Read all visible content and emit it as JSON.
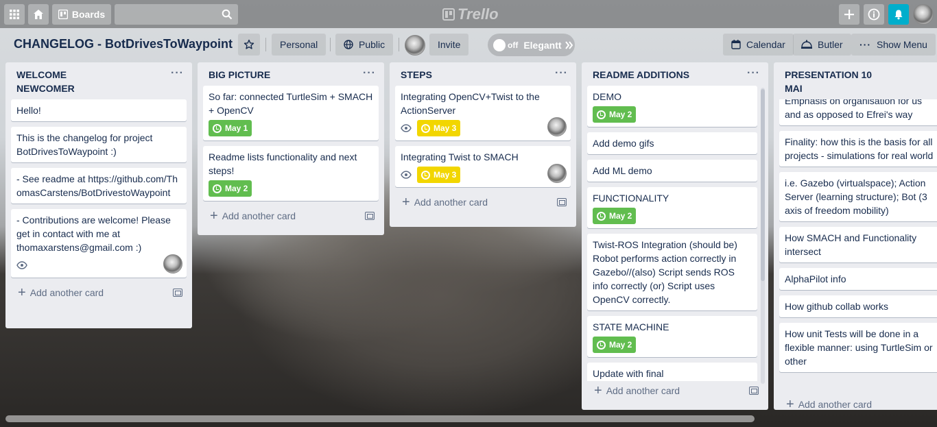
{
  "header": {
    "boards_label": "Boards",
    "logo_text": "Trello"
  },
  "board": {
    "title": "CHANGELOG - BotDrivesToWaypoint",
    "personal_label": "Personal",
    "public_label": "Public",
    "invite_label": "Invite",
    "toggle_state": "off",
    "toggle_label": "Elegantt",
    "calendar_label": "Calendar",
    "butler_label": "Butler",
    "show_menu_label": "Show Menu"
  },
  "footer_labels": {
    "add_card": "Add another card"
  },
  "lists": [
    {
      "title": "WELCOME NEWCOMER",
      "cards": [
        {
          "text": "Hello!"
        },
        {
          "text": "This is the changelog for project BotDrivesToWaypoint :)"
        },
        {
          "text": "- See readme at https://github.com/ThomasCarstens/BotDrivestoWaypoint"
        },
        {
          "text": "- Contributions are welcome! Please get in contact with me at thomaxarstens@gmail.com :)"
        }
      ]
    },
    {
      "title": "BIG PICTURE",
      "cards": [
        {
          "text": "So far: connected TurtleSim + SMACH + OpenCV",
          "date": "May 1"
        },
        {
          "text": "Readme lists functionality and next steps!",
          "date": "May 2"
        }
      ]
    },
    {
      "title": "STEPS",
      "cards": [
        {
          "text": "Integrating OpenCV+Twist to the ActionServer",
          "date": "May 3"
        },
        {
          "text": "Integrating Twist to SMACH",
          "date": "May 3"
        }
      ]
    },
    {
      "title": "README ADDITIONS",
      "cards": [
        {
          "text": "DEMO",
          "date": "May 2"
        },
        {
          "text": "Add demo gifs"
        },
        {
          "text": "Add ML demo"
        },
        {
          "text": "FUNCTIONALITY",
          "date": "May 2"
        },
        {
          "text": "Twist-ROS Integration (should be) Robot performs action correctly in Gazebo//(also) Script sends ROS info correctly (or) Script uses OpenCV correctly."
        },
        {
          "text": "STATE MACHINE",
          "date": "May 2"
        },
        {
          "text": "Update with final"
        }
      ]
    },
    {
      "title": "PRESENTATION 10 MAI",
      "cards": [
        {
          "text": "Emphasis on organisation for us and as opposed to Efrei's way"
        },
        {
          "text": "Finality: how this is the basis for all projects - simulations for real world"
        },
        {
          "text": "i.e. Gazebo (virtualspace); Action Server (learning structure); Bot (3 axis of freedom mobility)"
        },
        {
          "text": "How SMACH and Functionality intersect"
        },
        {
          "text": "AlphaPilot info"
        },
        {
          "text": "How github collab works"
        },
        {
          "text": "How unit Tests will be done in a flexible manner: using TurtleSim or other"
        }
      ]
    }
  ],
  "colors": {
    "date_green": "#61bd4f",
    "date_yellow": "#f2d600",
    "notification_accent": "#00aecc"
  }
}
